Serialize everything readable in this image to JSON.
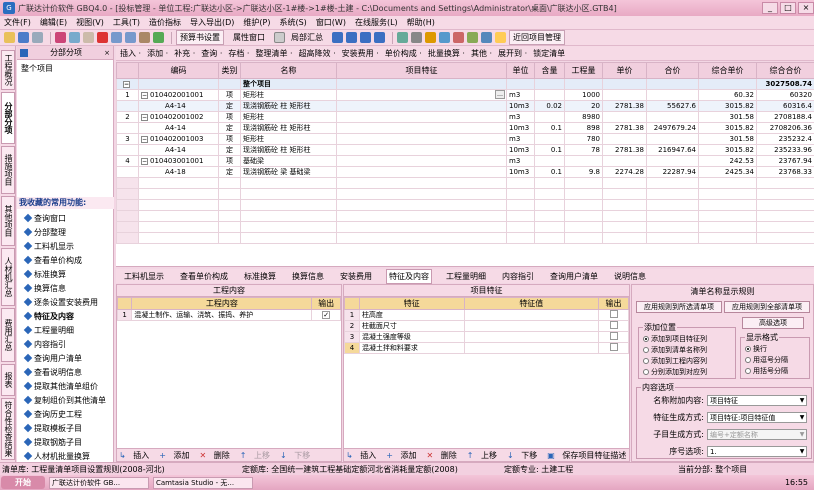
{
  "window": {
    "app_icon_text": "G",
    "title": "广联达计价软件 GBQ4.0 - [投标管理 - 单位工程:广联达小区->广联达小区-1#楼->1#楼-土建 - C:\\Documents and Settings\\Administrator\\桌面\\广联达小区.GTB4]",
    "minimize": "_",
    "maximize": "□",
    "close": "×"
  },
  "menu": [
    "文件(F)",
    "编辑(E)",
    "视图(V)",
    "工具(T)",
    "造价指标",
    "导入导出(D)",
    "维护(P)",
    "系统(S)",
    "窗口(W)",
    "在线服务(L)",
    "帮助(H)"
  ],
  "toolbar1": {
    "budget_settings": "预算书设置",
    "properties_window": "属性窗口",
    "partial_summary": "局部汇总",
    "recent_projects": "近回项目管理"
  },
  "toolbar2": [
    "插入 ·",
    "添加 ·",
    "补充 ·",
    "查询 ·",
    "存档 ·",
    "整理清单 ·",
    "超高降效 ·",
    "安装费用 ·",
    "单价构成 ·",
    "批量换算 ·",
    "其他 ·",
    "展开到 ·",
    "锁定清单"
  ],
  "left_rail": [
    {
      "label": "工程概况",
      "active": false
    },
    {
      "label": "分部分项",
      "active": true
    },
    {
      "label": "措施项目",
      "active": false
    },
    {
      "label": "其他项目",
      "active": false
    },
    {
      "label": "人材机汇总",
      "active": false
    },
    {
      "label": "费用汇总",
      "active": false
    },
    {
      "label": "报表",
      "active": false
    },
    {
      "label": "符合性检查结果",
      "active": false
    }
  ],
  "left_panel": {
    "header": "分部分项",
    "item": "整个项目",
    "favorites_title": "我收藏的常用功能:",
    "favorites": [
      {
        "label": "查询窗口",
        "active": false
      },
      {
        "label": "分部整理",
        "active": false
      },
      {
        "label": "工料机显示",
        "active": false
      },
      {
        "label": "查看单价构成",
        "active": false
      },
      {
        "label": "标准换算",
        "active": false
      },
      {
        "label": "换算信息",
        "active": false
      },
      {
        "label": "逐条设置安装费用",
        "active": false
      },
      {
        "label": "特征及内容",
        "active": true
      },
      {
        "label": "工程量明细",
        "active": false
      },
      {
        "label": "内容指引",
        "active": false
      },
      {
        "label": "查询用户清单",
        "active": false
      },
      {
        "label": "查看说明信息",
        "active": false
      },
      {
        "label": "提取其他清单组价",
        "active": false
      },
      {
        "label": "复制组价到其他清单",
        "active": false
      },
      {
        "label": "查询历史工程",
        "active": false
      },
      {
        "label": "提取模板子目",
        "active": false
      },
      {
        "label": "提取钢筋子目",
        "active": false
      },
      {
        "label": "人材机批量换算",
        "active": false
      }
    ]
  },
  "grid": {
    "columns": [
      "",
      "编码",
      "类别",
      "名称",
      "项目特征",
      "单位",
      "含量",
      "工程量",
      "单价",
      "合价",
      "综合单价",
      "综合合价"
    ],
    "group_row": {
      "name": "整个项目",
      "total": "3027508.74"
    },
    "rows": [
      {
        "no": "1",
        "code": "010402001001",
        "type": "项",
        "name": "矩形柱",
        "feature": "",
        "unit": "m3",
        "content": "",
        "qty": "1000",
        "price": "",
        "amount": "",
        "cprice": "60.32",
        "camount": "60320",
        "kind": "item"
      },
      {
        "no": "",
        "code": "A4-14",
        "type": "定",
        "name": "现浇钢筋砼 柱 矩形柱",
        "feature": "",
        "unit": "10m3",
        "content": "0.02",
        "qty": "20",
        "price": "2781.38",
        "amount": "55627.6",
        "cprice": "3015.82",
        "camount": "60316.4",
        "kind": "quota"
      },
      {
        "no": "2",
        "code": "010402001002",
        "type": "项",
        "name": "矩形柱",
        "feature": "",
        "unit": "m3",
        "content": "",
        "qty": "8980",
        "price": "",
        "amount": "",
        "cprice": "301.58",
        "camount": "2708188.4",
        "kind": "item"
      },
      {
        "no": "",
        "code": "A4-14",
        "type": "定",
        "name": "现浇钢筋砼 柱 矩形柱",
        "feature": "",
        "unit": "10m3",
        "content": "0.1",
        "qty": "898",
        "price": "2781.38",
        "amount": "2497679.24",
        "cprice": "3015.82",
        "camount": "2708206.36",
        "kind": "quota"
      },
      {
        "no": "3",
        "code": "010402001003",
        "type": "项",
        "name": "矩形柱",
        "feature": "",
        "unit": "m3",
        "content": "",
        "qty": "780",
        "price": "",
        "amount": "",
        "cprice": "301.58",
        "camount": "235232.4",
        "kind": "item"
      },
      {
        "no": "",
        "code": "A4-14",
        "type": "定",
        "name": "现浇钢筋砼 柱 矩形柱",
        "feature": "",
        "unit": "10m3",
        "content": "0.1",
        "qty": "78",
        "price": "2781.38",
        "amount": "216947.64",
        "cprice": "3015.82",
        "camount": "235233.96",
        "kind": "quota"
      },
      {
        "no": "4",
        "code": "010403001001",
        "type": "项",
        "name": "基础梁",
        "feature": "",
        "unit": "m3",
        "content": "",
        "qty": "",
        "price": "",
        "amount": "",
        "cprice": "242.53",
        "camount": "23767.94",
        "kind": "item"
      },
      {
        "no": "",
        "code": "A4-18",
        "type": "定",
        "name": "现浇钢筋砼 梁 基础梁",
        "feature": "",
        "unit": "10m3",
        "content": "0.1",
        "qty": "9.8",
        "price": "2274.28",
        "amount": "22287.94",
        "cprice": "2425.34",
        "camount": "23768.33",
        "kind": "quota"
      }
    ]
  },
  "tabs": [
    {
      "label": "工料机显示",
      "active": false
    },
    {
      "label": "查看单价构成",
      "active": false
    },
    {
      "label": "标准换算",
      "active": false
    },
    {
      "label": "换算信息",
      "active": false
    },
    {
      "label": "安装费用",
      "active": false
    },
    {
      "label": "特征及内容",
      "active": true
    },
    {
      "label": "工程量明细",
      "active": false
    },
    {
      "label": "内容指引",
      "active": false
    },
    {
      "label": "查询用户清单",
      "active": false
    },
    {
      "label": "说明信息",
      "active": false
    }
  ],
  "work_panel": {
    "title": "工程内容",
    "col_content": "工程内容",
    "col_output": "输出",
    "rows": [
      {
        "no": "1",
        "text": "混凝土制作、运输、浇筑、振捣、养护",
        "checked": true
      }
    ],
    "foot": [
      "插入",
      "添加",
      "删除",
      "上移",
      "下移"
    ]
  },
  "feat_panel": {
    "title": "项目特征",
    "col_feature": "特征",
    "col_value": "特征值",
    "col_output": "输出",
    "rows": [
      {
        "no": "1",
        "text": "柱高度"
      },
      {
        "no": "2",
        "text": "柱截面尺寸"
      },
      {
        "no": "3",
        "text": "混凝土强度等级"
      },
      {
        "no": "4",
        "text": "混凝土拌和料要求"
      }
    ],
    "foot": [
      "插入",
      "添加",
      "删除",
      "上移",
      "下移",
      "保存项目特征描述"
    ]
  },
  "rule_panel": {
    "title": "清单名称显示规则",
    "btn_apply_selected": "应用规则到所选清单项",
    "btn_apply_all": "应用规则到全部清单项",
    "btn_advanced": "高级选项",
    "add_pos_title": "添加位置",
    "add_pos": [
      {
        "label": "添加到项目特征列",
        "on": true
      },
      {
        "label": "添加到清单名称列",
        "on": false
      },
      {
        "label": "添加到工程内容列",
        "on": false
      },
      {
        "label": "分别添加到对应列",
        "on": false
      }
    ],
    "fmt_title": "显示格式",
    "fmt": [
      {
        "label": "换行",
        "on": true
      },
      {
        "label": "用逗号分隔",
        "on": false
      },
      {
        "label": "用括号分隔",
        "on": false
      }
    ],
    "content_title": "内容选项",
    "name_append_label": "名称附加内容:",
    "name_append_value": "项目特征",
    "feature_mode_label": "特征生成方式:",
    "feature_mode_value": "项目特征:项目特征值",
    "sub_mode_label": "子目生成方式:",
    "sub_mode_value": "编号+定额名称",
    "seq_label": "序号选项:",
    "seq_value": "1."
  },
  "status": {
    "list_base": "清单库:  工程量清单项目设置规则(2008-河北)",
    "quota_base": "定额库:  全国统一建筑工程基础定额河北省消耗量定额(2008)",
    "quota_major": "定额专业:  土建工程",
    "current_part": "当前分部:  整个项目"
  },
  "taskbar": {
    "start": "开始",
    "tasks": [
      "广联达计价软件 GB...",
      "Camtasia Studio - 无..."
    ],
    "clock": "16:55"
  }
}
